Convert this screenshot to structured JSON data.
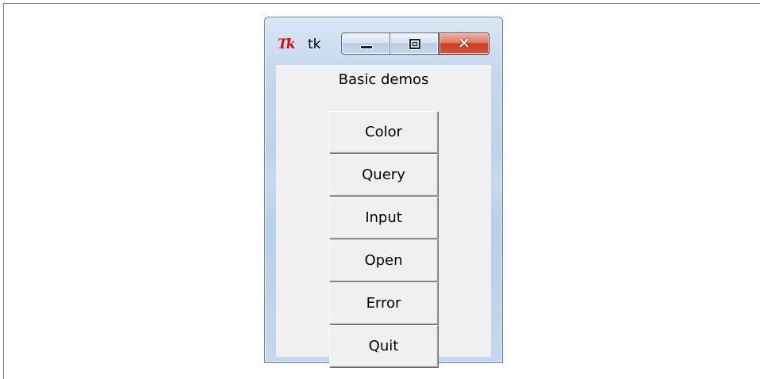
{
  "window": {
    "title": "tk",
    "icon": "tk-feather-icon",
    "close_glyph": "✕",
    "controls": [
      "minimize-icon",
      "maximize-icon",
      "close-icon"
    ]
  },
  "heading": "Basic demos",
  "buttons": [
    {
      "label": "Color"
    },
    {
      "label": "Query"
    },
    {
      "label": "Input"
    },
    {
      "label": "Open"
    },
    {
      "label": "Error"
    },
    {
      "label": "Quit"
    }
  ],
  "colors": {
    "client_background": "#f0f0f0",
    "close_button": "#c8402a",
    "logo": "#d01010"
  }
}
